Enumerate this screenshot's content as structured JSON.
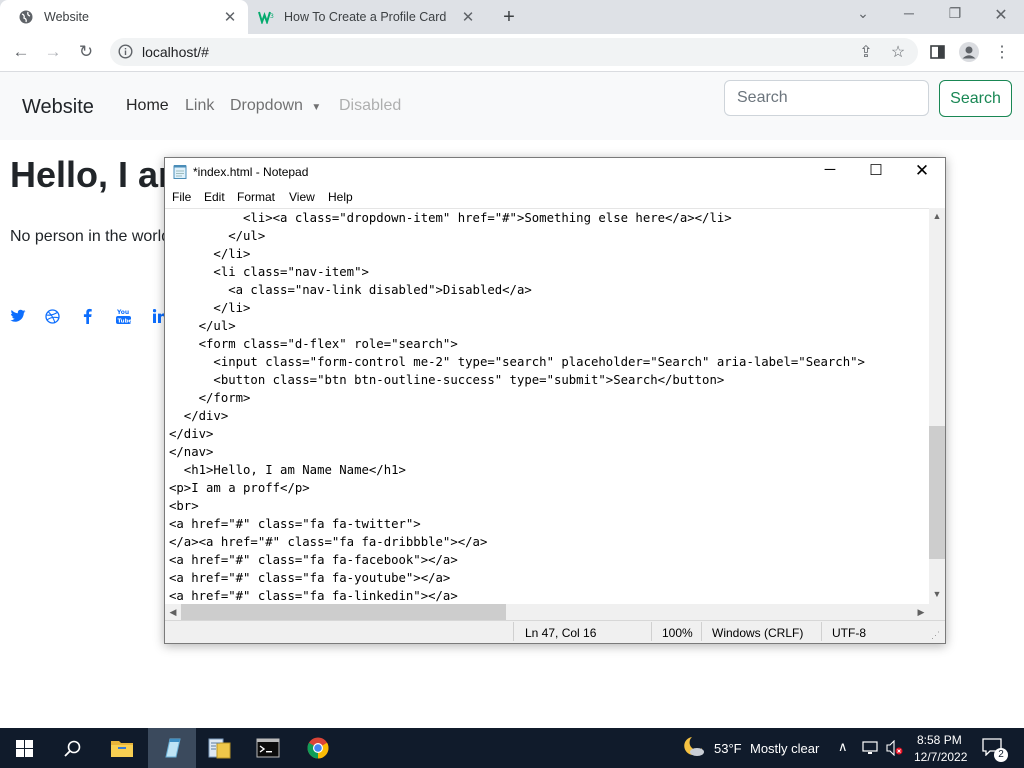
{
  "browser": {
    "tabs": [
      {
        "title": "Website",
        "active": true
      },
      {
        "title": "How To Create a Profile Card",
        "active": false
      }
    ],
    "url": "localhost/#"
  },
  "page": {
    "brand": "Website",
    "nav": [
      "Home",
      "Link",
      "Dropdown",
      "Disabled"
    ],
    "search_placeholder": "Search",
    "search_button": "Search",
    "hero_title": "Hello, I am Name Name",
    "hero_text": "No person in the world"
  },
  "notepad": {
    "title": "*index.html - Notepad",
    "menu": [
      "File",
      "Edit",
      "Format",
      "View",
      "Help"
    ],
    "code": "          <li><a class=\"dropdown-item\" href=\"#\">Something else here</a></li>\n        </ul>\n      </li>\n      <li class=\"nav-item\">\n        <a class=\"nav-link disabled\">Disabled</a>\n      </li>\n    </ul>\n    <form class=\"d-flex\" role=\"search\">\n      <input class=\"form-control me-2\" type=\"search\" placeholder=\"Search\" aria-label=\"Search\">\n      <button class=\"btn btn-outline-success\" type=\"submit\">Search</button>\n    </form>\n  </div>\n</div>\n</nav>\n  <h1>Hello, I am Name Name</h1>\n<p>I am a proff</p>\n<br>\n<a href=\"#\" class=\"fa fa-twitter\">\n</a><a href=\"#\" class=\"fa fa-dribbble\"></a>\n<a href=\"#\" class=\"fa fa-facebook\"></a>\n<a href=\"#\" class=\"fa fa-youtube\"></a>\n<a href=\"#\" class=\"fa fa-linkedin\"></a>",
    "status": {
      "position": "Ln 47, Col 16",
      "zoom": "100%",
      "line_ending": "Windows (CRLF)",
      "encoding": "UTF-8"
    }
  },
  "taskbar": {
    "weather_temp": "53°F",
    "weather_desc": "Mostly clear",
    "time": "8:58 PM",
    "date": "12/7/2022",
    "notifications": "2"
  },
  "colors": {
    "accent_success": "#198754",
    "link_blue": "#0d6efd",
    "taskbar": "#101b2b"
  }
}
